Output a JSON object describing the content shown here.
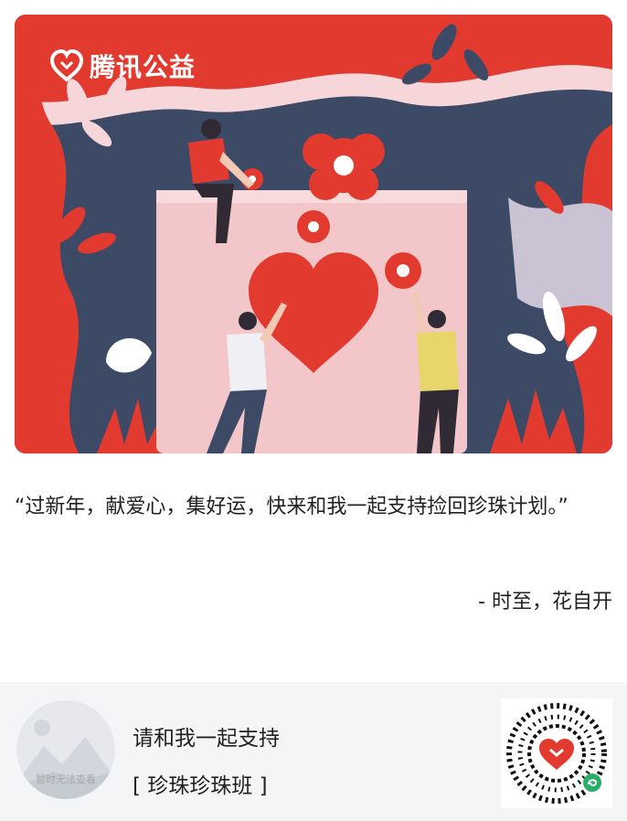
{
  "hero": {
    "brand_text": "腾讯公益",
    "brand_logo_icon": "heart-logo-icon",
    "colors": {
      "red": "#e33a2f",
      "navy": "#3c4a66",
      "pink": "#f3c6c9",
      "light_pink": "#f6d6d9",
      "white": "#ffffff"
    }
  },
  "message": {
    "quote": "“过新年，献爱心，集好运，快来和我一起支持捡回珍珠计划。”",
    "author": "- 时至，花自开"
  },
  "footer": {
    "thumbnail_text": "暂时无法查看",
    "support_text": "请和我一起支持",
    "project_text": "[ 珍珠珍珠班 ]",
    "qr_icon": "mini-program-qr-code-icon",
    "qr_badge_icon": "wechat-mini-program-badge-icon"
  }
}
